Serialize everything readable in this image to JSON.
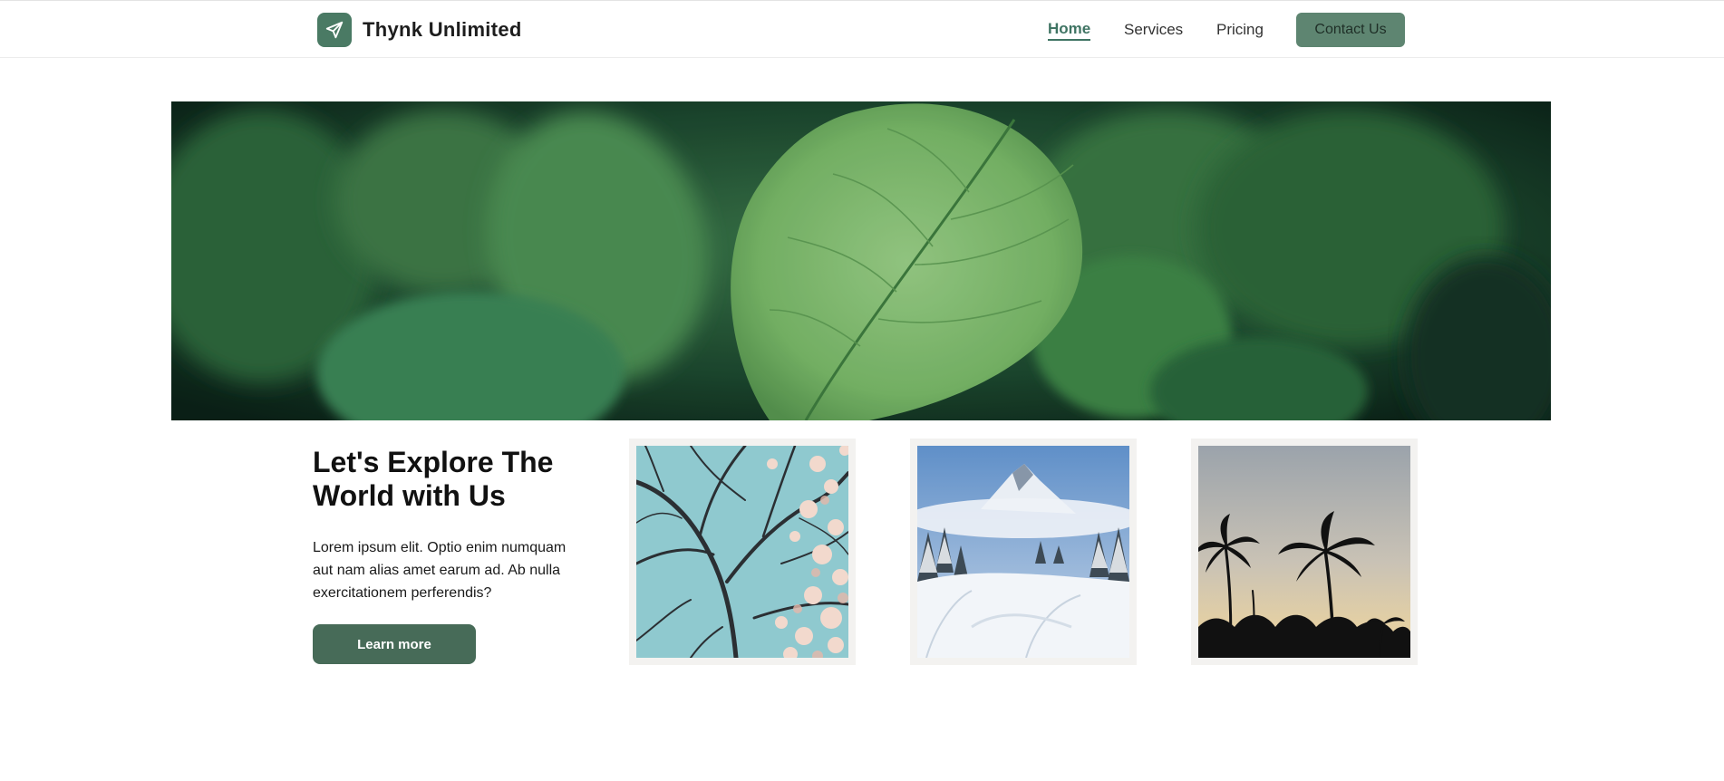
{
  "header": {
    "brand_name": "Thynk Unlimited",
    "brand_icon": "paper-plane-icon",
    "nav": [
      {
        "label": "Home",
        "active": true
      },
      {
        "label": "Services",
        "active": false
      },
      {
        "label": "Pricing",
        "active": false
      }
    ],
    "contact_label": "Contact Us"
  },
  "hero": {
    "image": "green-leaves-photo"
  },
  "intro": {
    "title": "Let's Explore The World with Us",
    "body": "Lorem ipsum elit. Optio enim numquam aut nam alias amet earum ad. Ab nulla exercitationem perferendis?",
    "button_label": "Learn more"
  },
  "gallery": [
    {
      "image": "cherry-blossom-branches-photo"
    },
    {
      "image": "snowy-mountain-photo"
    },
    {
      "image": "palm-tree-sunset-photo"
    }
  ],
  "colors": {
    "brand": "#4a7a64",
    "accent_text": "#3f7463",
    "contact_bg": "#5e8571",
    "button_bg": "#476b58"
  }
}
